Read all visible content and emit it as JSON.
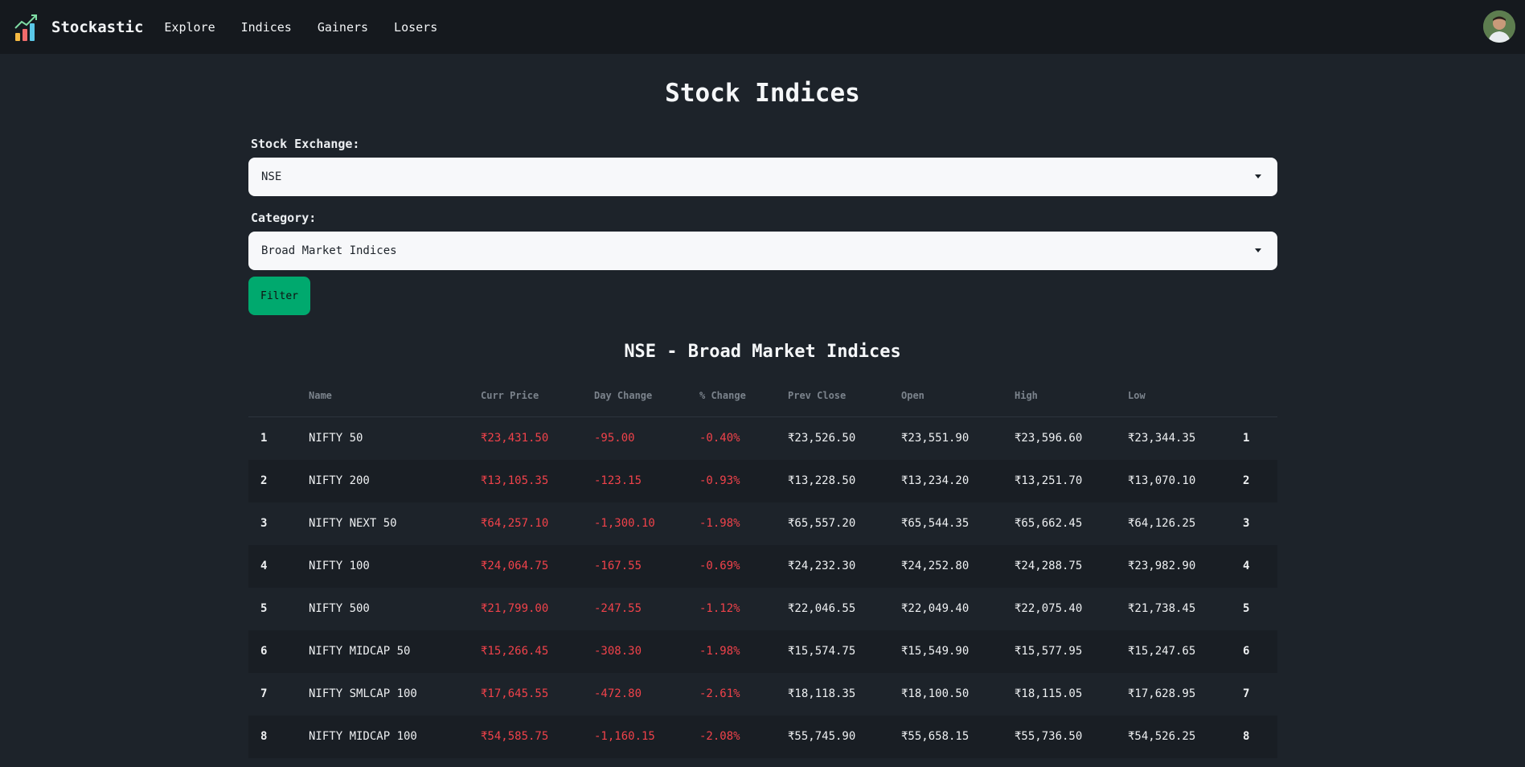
{
  "nav": {
    "brand": "Stockastic",
    "links": [
      "Explore",
      "Indices",
      "Gainers",
      "Losers"
    ]
  },
  "page": {
    "title": "Stock Indices"
  },
  "form": {
    "exchange_label": "Stock Exchange:",
    "exchange_value": "NSE",
    "category_label": "Category:",
    "category_value": "Broad Market Indices",
    "filter_label": "Filter"
  },
  "table": {
    "title": "NSE - Broad Market Indices",
    "headers": [
      "Name",
      "Curr Price",
      "Day Change",
      "% Change",
      "Prev Close",
      "Open",
      "High",
      "Low"
    ],
    "rows": [
      {
        "idx": "1",
        "name": "NIFTY 50",
        "curr": "₹23,431.50",
        "change": "-95.00",
        "pct": "-0.40%",
        "prev": "₹23,526.50",
        "open": "₹23,551.90",
        "high": "₹23,596.60",
        "low": "₹23,344.35",
        "rank": "1"
      },
      {
        "idx": "2",
        "name": "NIFTY 200",
        "curr": "₹13,105.35",
        "change": "-123.15",
        "pct": "-0.93%",
        "prev": "₹13,228.50",
        "open": "₹13,234.20",
        "high": "₹13,251.70",
        "low": "₹13,070.10",
        "rank": "2"
      },
      {
        "idx": "3",
        "name": "NIFTY NEXT 50",
        "curr": "₹64,257.10",
        "change": "-1,300.10",
        "pct": "-1.98%",
        "prev": "₹65,557.20",
        "open": "₹65,544.35",
        "high": "₹65,662.45",
        "low": "₹64,126.25",
        "rank": "3"
      },
      {
        "idx": "4",
        "name": "NIFTY 100",
        "curr": "₹24,064.75",
        "change": "-167.55",
        "pct": "-0.69%",
        "prev": "₹24,232.30",
        "open": "₹24,252.80",
        "high": "₹24,288.75",
        "low": "₹23,982.90",
        "rank": "4"
      },
      {
        "idx": "5",
        "name": "NIFTY 500",
        "curr": "₹21,799.00",
        "change": "-247.55",
        "pct": "-1.12%",
        "prev": "₹22,046.55",
        "open": "₹22,049.40",
        "high": "₹22,075.40",
        "low": "₹21,738.45",
        "rank": "5"
      },
      {
        "idx": "6",
        "name": "NIFTY MIDCAP 50",
        "curr": "₹15,266.45",
        "change": "-308.30",
        "pct": "-1.98%",
        "prev": "₹15,574.75",
        "open": "₹15,549.90",
        "high": "₹15,577.95",
        "low": "₹15,247.65",
        "rank": "6"
      },
      {
        "idx": "7",
        "name": "NIFTY SMLCAP 100",
        "curr": "₹17,645.55",
        "change": "-472.80",
        "pct": "-2.61%",
        "prev": "₹18,118.35",
        "open": "₹18,100.50",
        "high": "₹18,115.05",
        "low": "₹17,628.95",
        "rank": "7"
      },
      {
        "idx": "8",
        "name": "NIFTY MIDCAP 100",
        "curr": "₹54,585.75",
        "change": "-1,160.15",
        "pct": "-2.08%",
        "prev": "₹55,745.90",
        "open": "₹55,658.15",
        "high": "₹55,736.50",
        "low": "₹54,526.25",
        "rank": "8"
      }
    ]
  },
  "colors": {
    "background": "#1d232a",
    "navbar": "#15191e",
    "accent": "#00a96e",
    "negative": "#f0424a"
  }
}
